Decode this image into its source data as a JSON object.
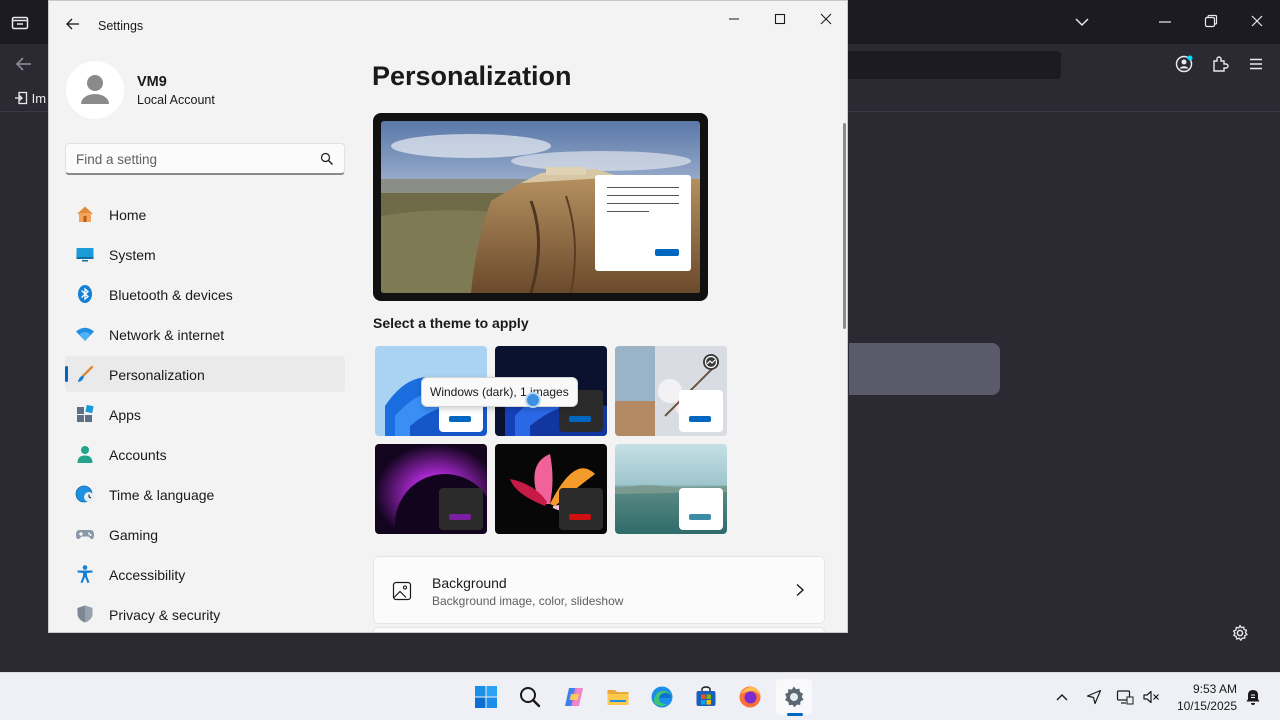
{
  "browser": {
    "bookmark_import_label": "Im",
    "icons": [
      "tab-list-icon",
      "chevron-down-icon",
      "minimize-icon",
      "restore-icon",
      "close-icon",
      "back-icon",
      "account-icon",
      "extensions-icon",
      "menu-icon",
      "gear-icon"
    ]
  },
  "settings": {
    "window_title": "Settings",
    "profile": {
      "name": "VM9",
      "account_type": "Local Account"
    },
    "search": {
      "placeholder": "Find a setting"
    },
    "nav": [
      {
        "label": "Home",
        "icon": "home-icon",
        "selected": false
      },
      {
        "label": "System",
        "icon": "system-icon",
        "selected": false
      },
      {
        "label": "Bluetooth & devices",
        "icon": "bluetooth-icon",
        "selected": false
      },
      {
        "label": "Network & internet",
        "icon": "wifi-icon",
        "selected": false
      },
      {
        "label": "Personalization",
        "icon": "brush-icon",
        "selected": true
      },
      {
        "label": "Apps",
        "icon": "apps-icon",
        "selected": false
      },
      {
        "label": "Accounts",
        "icon": "person-icon",
        "selected": false
      },
      {
        "label": "Time & language",
        "icon": "globe-clock-icon",
        "selected": false
      },
      {
        "label": "Gaming",
        "icon": "gamepad-icon",
        "selected": false
      },
      {
        "label": "Accessibility",
        "icon": "accessibility-icon",
        "selected": false
      },
      {
        "label": "Privacy & security",
        "icon": "shield-icon",
        "selected": false
      }
    ],
    "page_title": "Personalization",
    "theme_section_title": "Select a theme to apply",
    "tooltip": "Windows (dark), 1 images",
    "themes": [
      {
        "name": "windows-light",
        "accent": "#0067c0"
      },
      {
        "name": "windows-dark",
        "accent": "#0067c0"
      },
      {
        "name": "flowers",
        "accent": "#0067c0"
      },
      {
        "name": "glow",
        "accent": "#7a1fa2"
      },
      {
        "name": "captured-motion",
        "accent": "#d01010"
      },
      {
        "name": "sunrise",
        "accent": "#3d8aa6"
      }
    ],
    "background_card": {
      "title": "Background",
      "description": "Background image, color, slideshow"
    },
    "accent_color": "#0067c0"
  },
  "taskbar": {
    "apps": [
      "start-icon",
      "search-icon",
      "copilot-icon",
      "file-explorer-icon",
      "edge-icon",
      "store-icon",
      "firefox-icon",
      "settings-icon"
    ],
    "time": "9:53 AM",
    "date": "10/15/2025"
  }
}
